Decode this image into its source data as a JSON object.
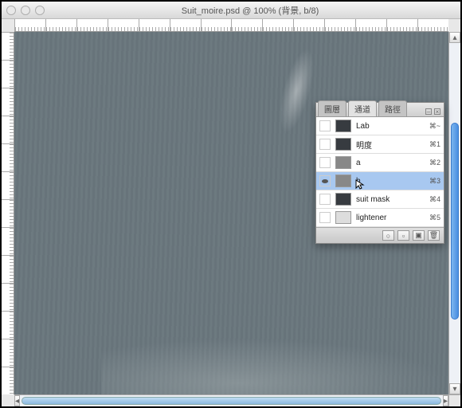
{
  "window": {
    "title": "Suit_moire.psd @ 100% (背景, b/8)"
  },
  "panel": {
    "tabs": [
      "圖層",
      "通道",
      "路徑"
    ],
    "active_tab": 1,
    "channels": [
      {
        "name": "Lab",
        "cmd": "⌘~",
        "eye": false,
        "thumb": "d"
      },
      {
        "name": "明度",
        "cmd": "⌘1",
        "eye": false,
        "thumb": "d"
      },
      {
        "name": "a",
        "cmd": "⌘2",
        "eye": false,
        "thumb": "g"
      },
      {
        "name": "b",
        "cmd": "⌘3",
        "eye": true,
        "thumb": "g",
        "selected": true
      },
      {
        "name": "suit mask",
        "cmd": "⌘4",
        "eye": false,
        "thumb": "d"
      },
      {
        "name": "lightener",
        "cmd": "⌘5",
        "eye": false,
        "thumb": "w"
      }
    ]
  }
}
